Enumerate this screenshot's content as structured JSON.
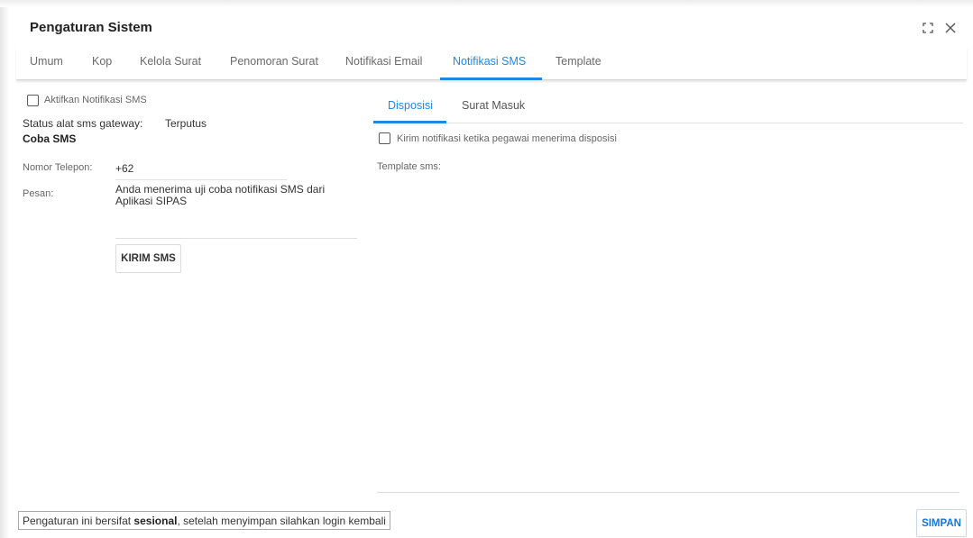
{
  "window": {
    "title": "Pengaturan Sistem",
    "maximize_icon": "expand-icon",
    "close_icon": "close-icon"
  },
  "tabs": [
    {
      "label": "Umum"
    },
    {
      "label": "Kop"
    },
    {
      "label": "Kelola Surat"
    },
    {
      "label": "Penomoran Surat"
    },
    {
      "label": "Notifikasi Email"
    },
    {
      "label": "Notifikasi SMS",
      "active": true
    },
    {
      "label": "Template"
    }
  ],
  "sms_panel": {
    "enable_label": "Aktifkan Notifikasi SMS",
    "enable_checked": false,
    "status_label": "Status alat sms gateway:",
    "status_value": "Terputus",
    "test_heading": "Coba SMS",
    "phone_label": "Nomor Telepon:",
    "phone_value": "+62",
    "message_label": "Pesan:",
    "message_value": "Anda menerima uji coba notifikasi SMS dari Aplikasi SIPAS",
    "send_button": "KIRIM SMS"
  },
  "notif_panel": {
    "subtabs": [
      {
        "label": "Disposisi",
        "active": true
      },
      {
        "label": "Surat Masuk"
      }
    ],
    "notify_label": "Kirim notifikasi ketika pegawai menerima disposisi",
    "notify_checked": false,
    "template_label": "Template sms:",
    "template_value": ""
  },
  "footer": {
    "note_prefix": "Pengaturan ini bersifat ",
    "note_bold": "sesional",
    "note_suffix": ", setelah menyimpan silahkan login kembali",
    "save_button": "SIMPAN"
  },
  "colors": {
    "accent": "#1e88e5",
    "text": "#212121",
    "muted": "#666666"
  }
}
